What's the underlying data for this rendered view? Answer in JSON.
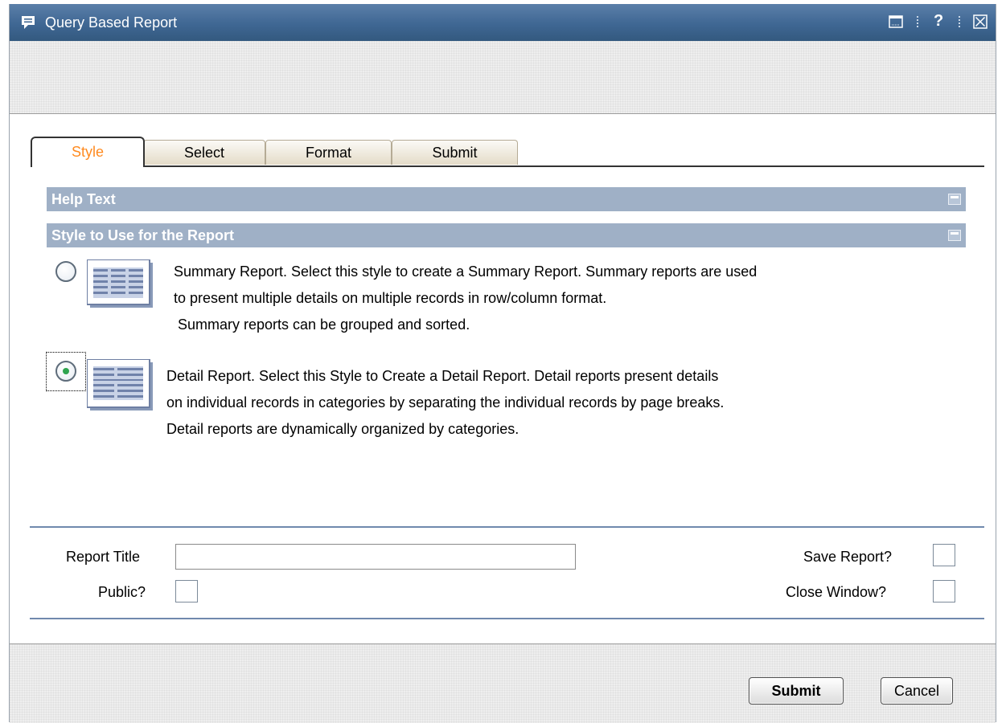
{
  "window": {
    "title": "Query Based Report",
    "controls": [
      "restore-icon",
      "help-icon",
      "close-icon"
    ],
    "help_glyph": "?"
  },
  "tabs": [
    {
      "label": "Style",
      "active": true
    },
    {
      "label": "Select",
      "active": false
    },
    {
      "label": "Format",
      "active": false
    },
    {
      "label": "Submit",
      "active": false
    }
  ],
  "sections": {
    "help_text": "Help Text",
    "style_to_use": "Style to Use for the Report"
  },
  "styles": {
    "summary": {
      "selected": false,
      "lines": [
        "Summary Report. Select this style to create a Summary Report. Summary reports are used",
        "to present multiple details on multiple records in row/column format.",
        " Summary reports can be grouped and sorted."
      ]
    },
    "detail": {
      "selected": true,
      "lines": [
        "Detail Report. Select this Style to Create a Detail Report. Detail reports present details",
        "on individual records in categories by separating the individual records by page breaks.",
        "Detail reports are dynamically organized by categories."
      ]
    }
  },
  "form": {
    "report_title_label": "Report Title",
    "report_title_value": "",
    "public_label": "Public?",
    "save_report_label": "Save Report?",
    "close_window_label": "Close Window?"
  },
  "buttons": {
    "submit": "Submit",
    "cancel": "Cancel"
  },
  "colors": {
    "titlebar": "#3f6793",
    "section_header": "#9fb0c6",
    "active_tab_text": "#ff8a1f",
    "divider": "#7089ad",
    "radio_selected": "#2fa44f"
  }
}
